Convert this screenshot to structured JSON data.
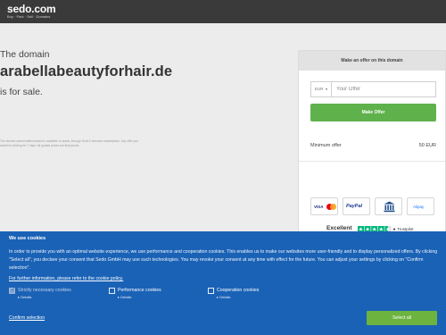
{
  "header": {
    "logo": "sedo.com",
    "tagline": "Buy · Park · Sell · Domains"
  },
  "landing": {
    "intro": "The domain",
    "domain": "arabellabeautyforhair.de",
    "sale": "is for sale.",
    "finetext": "The domain owner/seller/contact is available to assist, through Sedo it licensed marketplace. Any offer you submit is binding for 7 days. All quoted prices are final prices."
  },
  "offer": {
    "heading": "Make an offer on this domain",
    "currency": "EUR",
    "input_placeholder": "Your Offer",
    "button": "Make Offer",
    "min_label": "Minimum offer",
    "min_value": "50 EUR"
  },
  "payments": {
    "visa": "VISA",
    "paypal": "PayPal",
    "alipay": "Alipay"
  },
  "trust": {
    "label": "Excellent",
    "brand": "★ Trustpilot"
  },
  "cookie": {
    "title": "We use cookies",
    "body": "In order to provide you with an optimal website experience, we use performance and cooperation cookies. This enables us to make our websites more user-friendly and to display personalized offers. By clicking \"Select all\", you declare your consent that Sedo GmbH may use such technologies. You may revoke your consent at any time with effect for the future. You can adjust your settings by clicking on \"Confirm selection\".",
    "link": "For further information, please refer to the cookie policy.",
    "options": [
      {
        "label": "Strictly necessary cookies",
        "details": "▸ Details"
      },
      {
        "label": "Performance cookies",
        "details": "▸ Details"
      },
      {
        "label": "Cooperation cookies",
        "details": "▸ Details"
      }
    ],
    "confirm": "Confirm selection",
    "select_all": "Select all"
  },
  "colors": {
    "header_bg": "#3a3a3a",
    "accent_green": "#5fb14c",
    "cookie_blue": "#1a62b6",
    "trust_green": "#00b67a"
  }
}
